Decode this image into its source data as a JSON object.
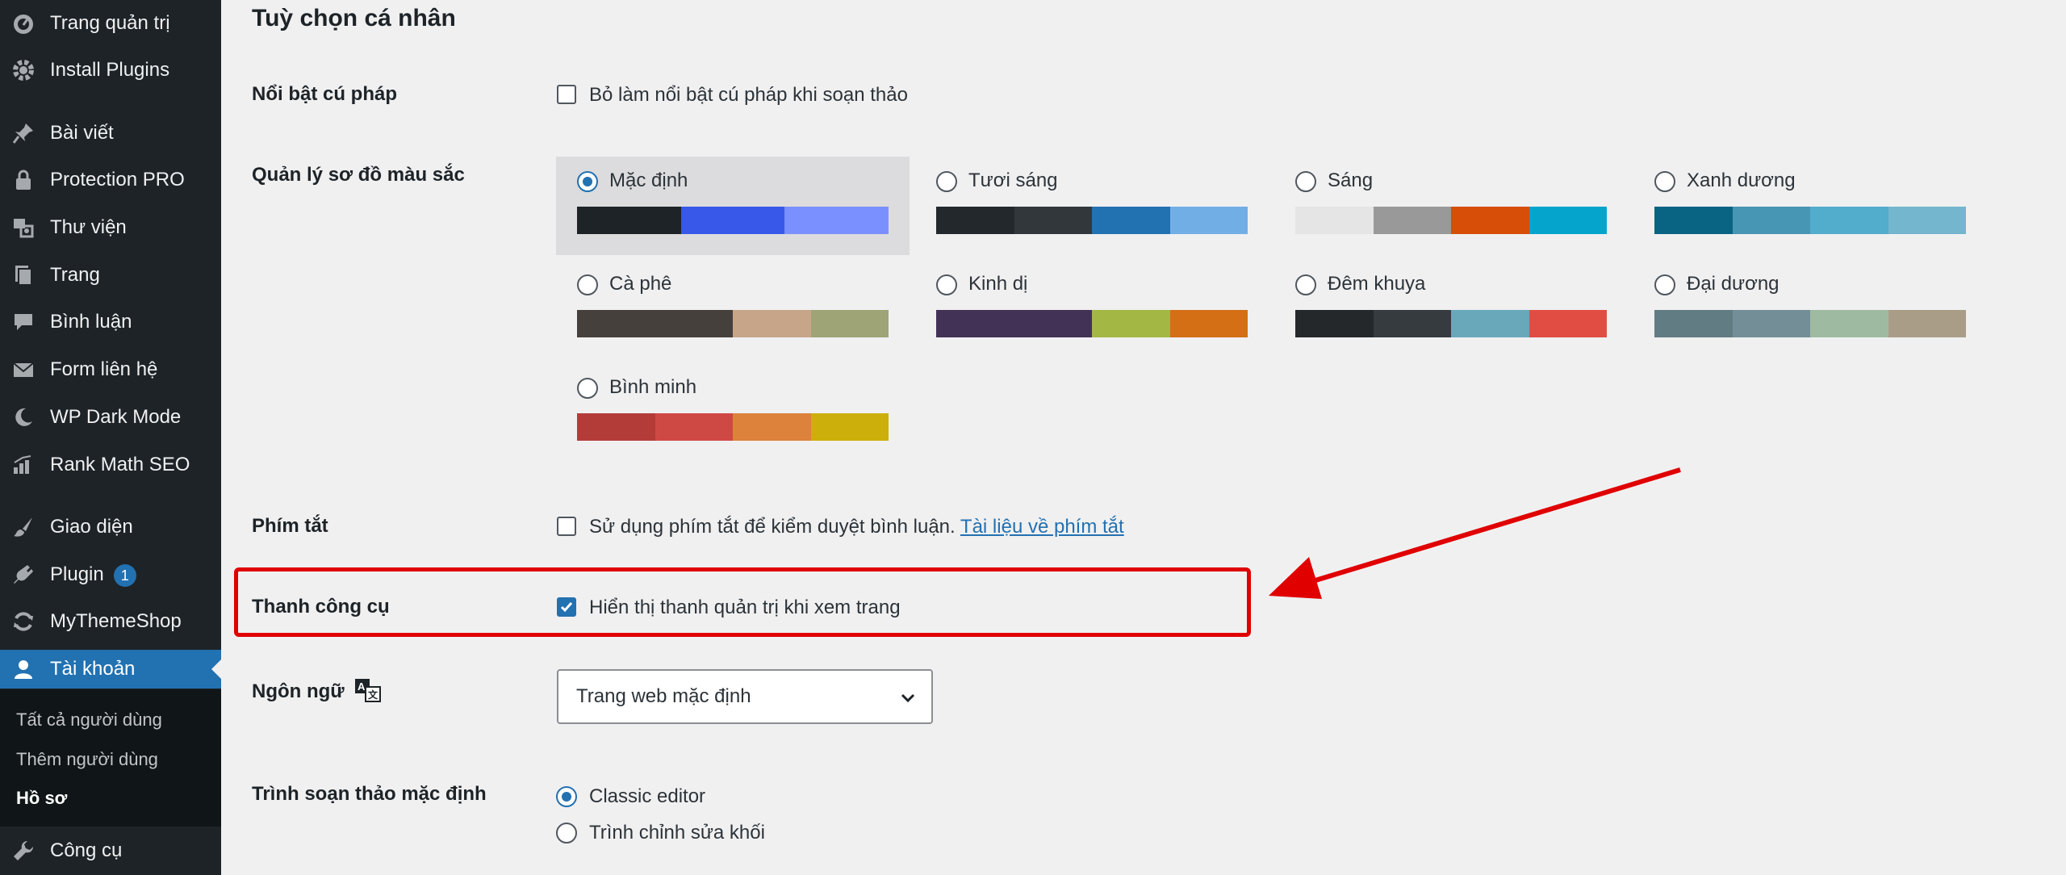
{
  "sidebar": {
    "items": [
      {
        "label": "Trang quản trị",
        "icon": "dashboard-icon"
      },
      {
        "label": "Install Plugins",
        "icon": "gear-icon"
      },
      {
        "label": "Bài viết",
        "icon": "pin-icon"
      },
      {
        "label": "Protection PRO",
        "icon": "lock-icon"
      },
      {
        "label": "Thư viện",
        "icon": "media-icon"
      },
      {
        "label": "Trang",
        "icon": "pages-icon"
      },
      {
        "label": "Bình luận",
        "icon": "comment-icon"
      },
      {
        "label": "Form liên hệ",
        "icon": "envelope-icon"
      },
      {
        "label": "WP Dark Mode",
        "icon": "moon-icon"
      },
      {
        "label": "Rank Math SEO",
        "icon": "chart-icon"
      },
      {
        "label": "Giao diện",
        "icon": "brush-icon"
      },
      {
        "label": "Plugin",
        "icon": "plugin-icon",
        "badge": "1"
      },
      {
        "label": "MyThemeShop",
        "icon": "refresh-icon"
      },
      {
        "label": "Tài khoản",
        "icon": "user-icon",
        "active": true
      },
      {
        "label": "Công cụ",
        "icon": "wrench-icon"
      }
    ],
    "submenu": [
      "Tất cả người dùng",
      "Thêm người dùng",
      "Hồ sơ"
    ]
  },
  "main": {
    "title": "Tuỳ chọn cá nhân",
    "syntax": {
      "label": "Nổi bật cú pháp",
      "checkbox": "Bỏ làm nổi bật cú pháp khi soạn thảo",
      "checked": false
    },
    "color_scheme": {
      "label": "Quản lý sơ đồ màu sắc",
      "schemes": [
        {
          "name": "Mặc định",
          "selected": true,
          "colors": [
            "#1d2327",
            "#2c3338",
            "#3858e9",
            "#7b90ff"
          ]
        },
        {
          "name": "Tươi sáng",
          "selected": false,
          "colors": [
            "#23282d",
            "#32373c",
            "#2271b1",
            "#72aee6"
          ]
        },
        {
          "name": "Sáng",
          "selected": false,
          "colors": [
            "#e5e5e5",
            "#999999",
            "#d64e07",
            "#04a4cc"
          ]
        },
        {
          "name": "Xanh dương",
          "selected": false,
          "colors": [
            "#096484",
            "#4796b3",
            "#52accc",
            "#74b6ce"
          ]
        },
        {
          "name": "Cà phê",
          "selected": false,
          "colors": [
            "#46403c",
            "#46403c",
            "#c7a589",
            "#9ea476"
          ]
        },
        {
          "name": "Kinh dị",
          "selected": false,
          "colors": [
            "#413256",
            "#413256",
            "#a3b745",
            "#d46f15"
          ]
        },
        {
          "name": "Đêm khuya",
          "selected": false,
          "colors": [
            "#25282b",
            "#363b3f",
            "#69a8bb",
            "#e14d43"
          ]
        },
        {
          "name": "Đại dương",
          "selected": false,
          "colors": [
            "#627c83",
            "#738e96",
            "#9ebaa0",
            "#aa9d88"
          ]
        },
        {
          "name": "Bình minh",
          "selected": false,
          "colors": [
            "#b43c38",
            "#cf4944",
            "#dd823b",
            "#ccaf0b"
          ]
        }
      ]
    },
    "shortcuts": {
      "label": "Phím tắt",
      "checkbox": "Sử dụng phím tắt để kiểm duyệt bình luận.",
      "link": "Tài liệu về phím tắt",
      "checked": false
    },
    "toolbar": {
      "label": "Thanh công cụ",
      "checkbox": "Hiển thị thanh quản trị khi xem trang",
      "checked": true
    },
    "language": {
      "label": "Ngôn ngữ",
      "value": "Trang web mặc định"
    },
    "editor": {
      "label": "Trình soạn thảo mặc định",
      "options": [
        {
          "label": "Classic editor",
          "selected": true
        },
        {
          "label": "Trình chỉnh sửa khối",
          "selected": false
        }
      ]
    }
  },
  "colors": {
    "annotation": "#e00000",
    "accent": "#2271b1"
  }
}
